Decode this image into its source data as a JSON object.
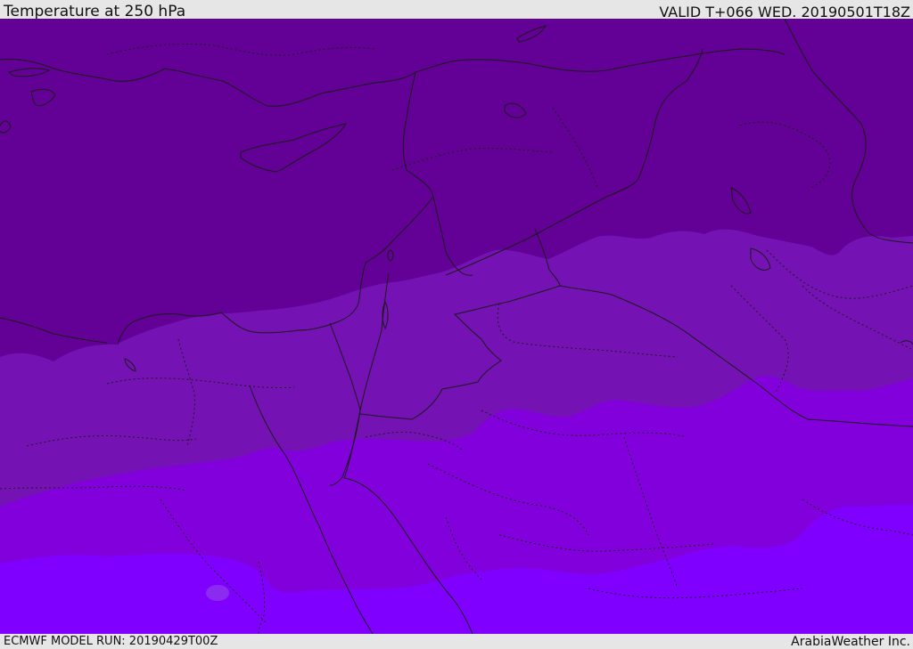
{
  "header": {
    "title": "Temperature at 250 hPa",
    "valid": "VALID T+066 WED. 20190501T18Z"
  },
  "footer": {
    "model_run": "ECMWF MODEL RUN: 20190429T00Z",
    "credit": "ArabiaWeather Inc."
  },
  "colors": {
    "band_coldest": "#630096",
    "band_cold": "#7412b4",
    "band_mid": "#8200dc",
    "band_warm": "#8000ff",
    "coast": "#1a1a1a",
    "border": "#1a1a1a",
    "frame_bg": "#e6e6e6"
  },
  "map": {
    "field": "temperature-250hpa",
    "legend": "none"
  }
}
